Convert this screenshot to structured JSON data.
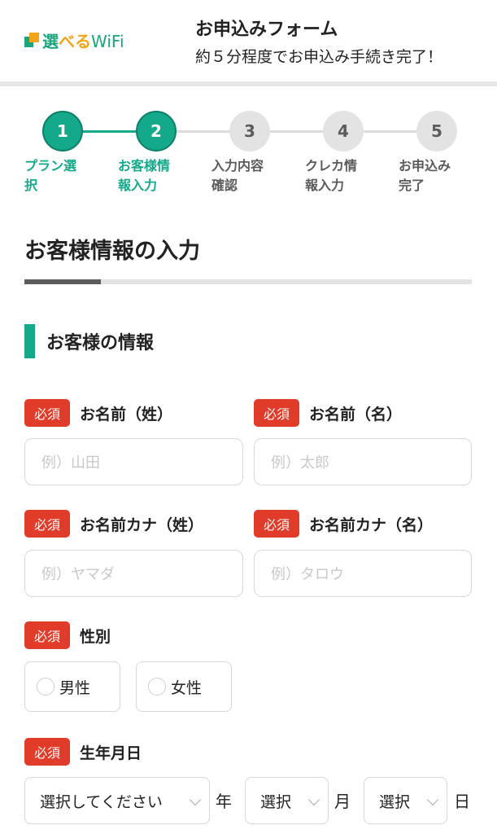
{
  "header": {
    "logo": {
      "part1": "選",
      "part2": "べる",
      "part3": "WiFi"
    },
    "title": "お申込みフォーム",
    "subtitle": "約５分程度でお申込み手続き完了！"
  },
  "steps": [
    {
      "number": "1",
      "line1": "プラン選",
      "line2": "択",
      "state": "done"
    },
    {
      "number": "2",
      "line1": "お客様情",
      "line2": "報入力",
      "state": "current"
    },
    {
      "number": "3",
      "line1": "入力内容",
      "line2": "確認",
      "state": "todo"
    },
    {
      "number": "4",
      "line1": "クレカ情",
      "line2": "報入力",
      "state": "todo"
    },
    {
      "number": "5",
      "line1": "お申込み",
      "line2": "完了",
      "state": "todo"
    }
  ],
  "section": {
    "title": "お客様情報の入力",
    "progress": 0.17,
    "subheading": "お客様の情報"
  },
  "required_label": "必須",
  "fields": {
    "last_name": {
      "label": "お名前（姓）",
      "placeholder": "例）山田"
    },
    "first_name": {
      "label": "お名前（名）",
      "placeholder": "例）太郎"
    },
    "last_name_kana": {
      "label": "お名前カナ（姓）",
      "placeholder": "例）ヤマダ"
    },
    "first_name_kana": {
      "label": "お名前カナ（名）",
      "placeholder": "例）タロウ"
    },
    "gender": {
      "label": "性別",
      "options": [
        "男性",
        "女性"
      ]
    },
    "birthday": {
      "label": "生年月日",
      "year_value": "選択してください",
      "year_unit": "年",
      "month_value": "選択",
      "month_unit": "月",
      "day_value": "選択",
      "day_unit": "日"
    }
  },
  "colors": {
    "accent": "#14a98a",
    "required": "#e13b2a",
    "logo_orange": "#f2a516"
  }
}
